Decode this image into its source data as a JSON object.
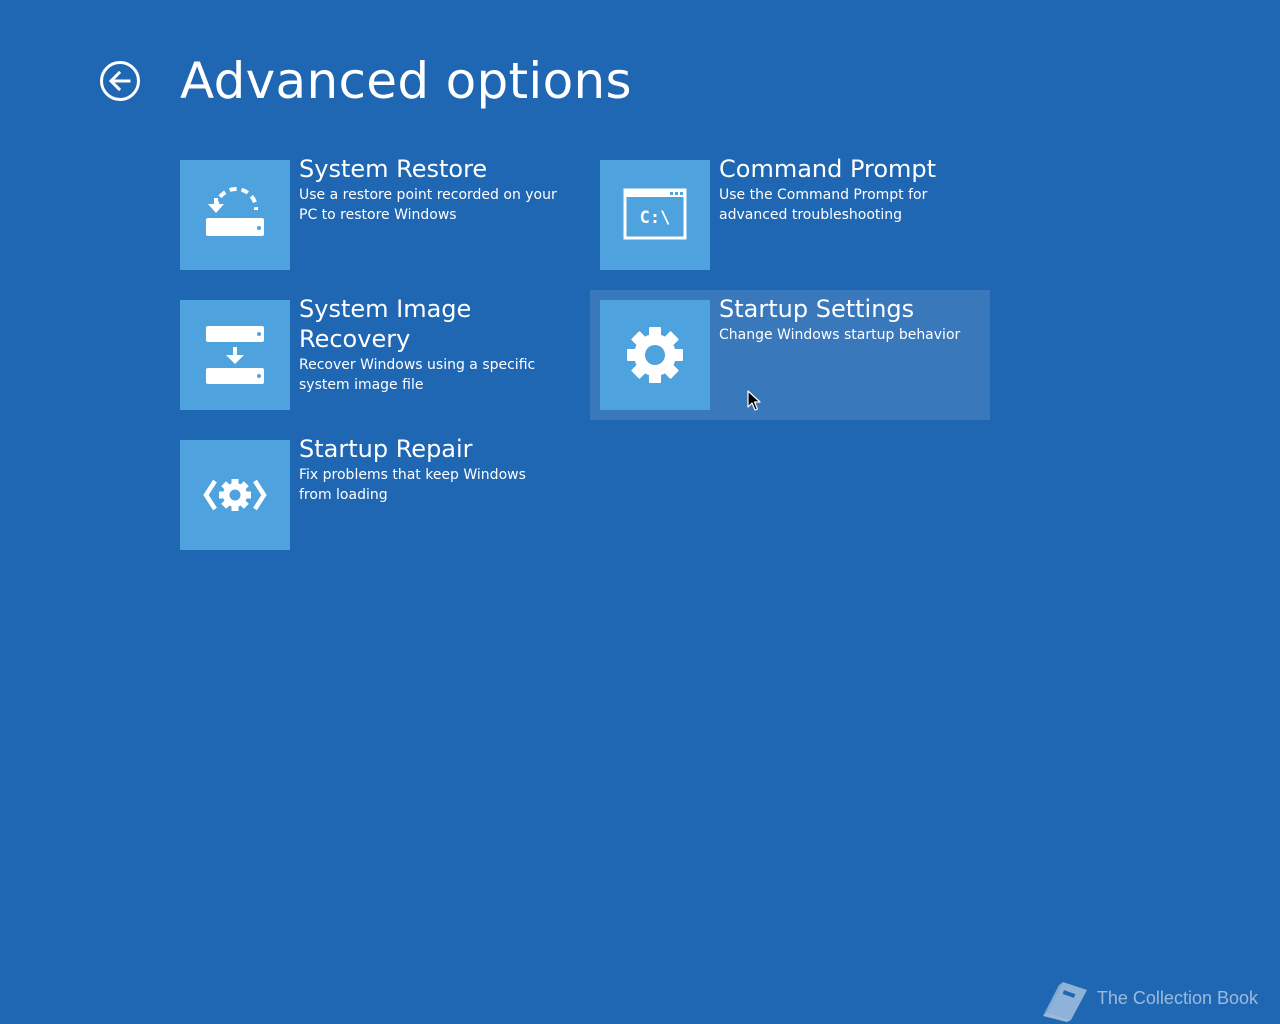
{
  "header": {
    "title": "Advanced options",
    "back_icon": "back-arrow-circle-icon"
  },
  "options": [
    {
      "title": "System Restore",
      "description": "Use a restore point recorded on your PC to restore Windows",
      "icon": "system-restore-icon"
    },
    {
      "title": "Command Prompt",
      "description": "Use the Command Prompt for advanced troubleshooting",
      "icon": "command-prompt-icon",
      "icon_text": "C:\\"
    },
    {
      "title": "System Image Recovery",
      "description": "Recover Windows using a specific system image file",
      "icon": "system-image-recovery-icon"
    },
    {
      "title": "Startup Settings",
      "description": "Change Windows startup behavior",
      "icon": "gear-icon",
      "hovered": true
    },
    {
      "title": "Startup Repair",
      "description": "Fix problems that keep Windows from loading",
      "icon": "startup-repair-icon"
    }
  ],
  "watermark": {
    "text": "The Collection Book",
    "icon": "book-icon"
  },
  "colors": {
    "background": "#1f66b3",
    "tile": "#4ea3de",
    "text": "#ffffff"
  }
}
